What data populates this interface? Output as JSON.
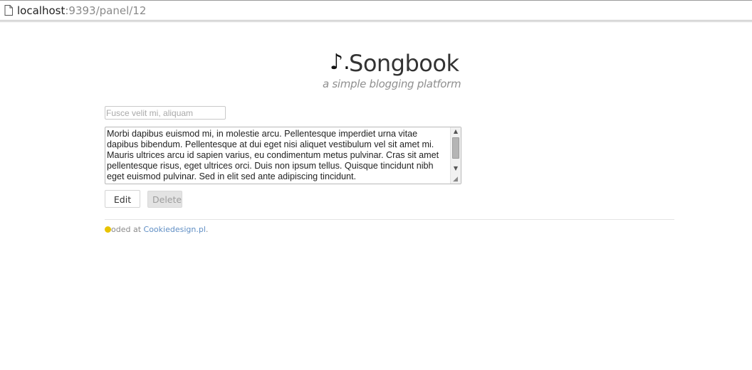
{
  "browser": {
    "url_host": "localhost",
    "url_rest": ":9393/panel/12",
    "page_icon": "page-icon"
  },
  "header": {
    "logo_icon": "♪.",
    "title": "Songbook",
    "subtitle": "a simple blogging platform"
  },
  "form": {
    "title_placeholder": "Fusce velit mi, aliquam",
    "title_value": "",
    "body_text": "Morbi dapibus euismod mi, in molestie arcu. Pellentesque imperdiet urna vitae dapibus bibendum. Pellentesque at dui eget nisi aliquet vestibulum vel sit amet mi. Mauris ultrices arcu id sapien varius, eu condimentum metus pulvinar. Cras sit amet pellentesque risus, eget ultrices orci. Duis non ipsum tellus. Quisque tincidunt nibh eget euismod pulvinar. Sed in elit sed ante adipiscing tincidunt.",
    "edit_label": "Edit",
    "delete_label": "Delete"
  },
  "footer": {
    "icon": "cookie-icon",
    "text": "oded at ",
    "link_label": "Cookiedesign.pl",
    "suffix": "."
  },
  "colors": {
    "link": "#5f8ec4",
    "cookie": "#e8c300",
    "delete_bg": "#e3e3e3"
  }
}
